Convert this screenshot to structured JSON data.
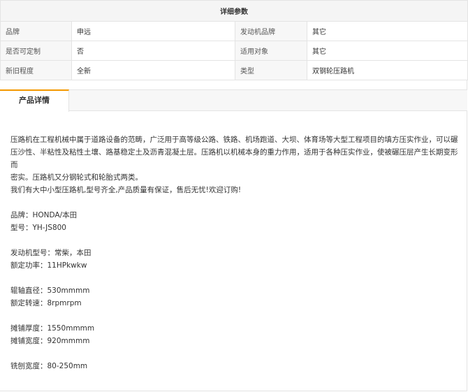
{
  "specs": {
    "title": "详细参数",
    "rows": [
      [
        {
          "label": "品牌",
          "value": "申远"
        },
        {
          "label": "发动机品牌",
          "value": "其它"
        }
      ],
      [
        {
          "label": "是否可定制",
          "value": "否"
        },
        {
          "label": "适用对象",
          "value": "其它"
        }
      ],
      [
        {
          "label": "新旧程度",
          "value": "全新"
        },
        {
          "label": "类型",
          "value": "双钢轮压路机"
        }
      ]
    ]
  },
  "tabs": {
    "active_label": "产品详情"
  },
  "details": {
    "intro_line1": "压路机在工程机械中属于道路设备的范畴，广泛用于高等级公路、铁路、机场跑道、大坝、体育场等大型工程项目的填方压实作业，可以碾",
    "intro_line2": "压沙性、半粘性及粘性土壤、路基稳定土及沥青混凝土层。压路机以机械本身的重力作用，适用于各种压实作业，使被碾压层产生长期变形而",
    "intro_line3": "密实。压路机又分钢轮式和轮胎式两类。",
    "intro_line4": "我们有大中小型压路机,型号齐全,产品质量有保证，售后无忧!欢迎订购!",
    "brand": "品牌：HONDA/本田",
    "model": "型号：YH-JS800",
    "engine_model": "发动机型号：常柴，本田",
    "rated_power": "额定功率：11HPkwkw",
    "roller_diameter": "辊轴直径：530mmmm",
    "rated_speed": "额定转速：8rpmrpm",
    "paving_thickness": "摊铺厚度：1550mmmm",
    "paving_width": "摊铺宽度：920mmmm",
    "milling_width": "铣刨宽度：80-250mm"
  }
}
